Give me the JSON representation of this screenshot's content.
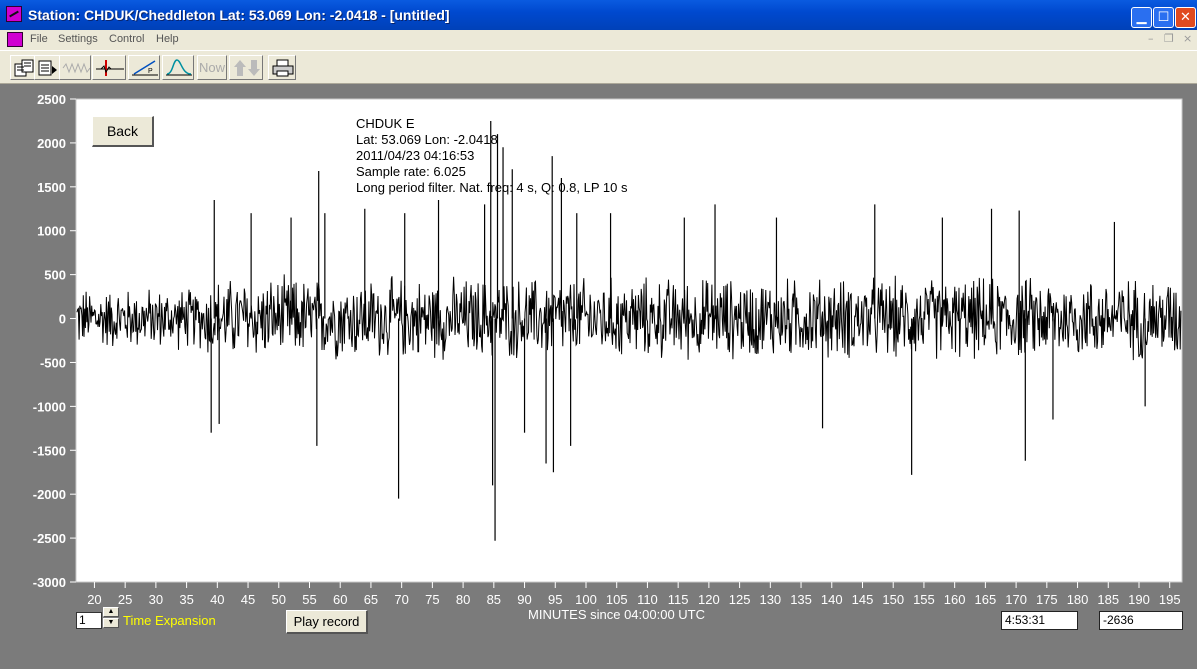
{
  "window": {
    "title": "Station: CHDUK/Cheddleton Lat: 53.069 Lon: -2.0418 - [untitled]",
    "controls": {
      "minimize": "▁",
      "maximize": "☐",
      "close": "✕"
    }
  },
  "menu": {
    "items": [
      "File",
      "Settings",
      "Control",
      "Help"
    ],
    "mdi": {
      "minimize": "–",
      "restore": "❐",
      "close": "×"
    }
  },
  "toolbar": {
    "now_label": "Now",
    "buttons": [
      "open-icon",
      "save-icon",
      "waveform-icon",
      "pick-icon",
      "pwave-icon",
      "spectrum-icon",
      "now-icon",
      "updown-arrows-icon",
      "print-icon"
    ]
  },
  "plot": {
    "back_label": "Back",
    "info": [
      "CHDUK  E",
      "Lat: 53.069 Lon: -2.0418",
      "2011/04/23 04:16:53",
      "Sample rate: 6.025",
      "Long period filter. Nat. freq: 4 s, Q: 0.8, LP 10 s"
    ],
    "xlabel": "MINUTES since 04:00:00 UTC"
  },
  "chart_data": {
    "type": "line",
    "xlabel": "MINUTES since 04:00:00 UTC",
    "ylabel": "",
    "xlim": [
      17,
      197
    ],
    "ylim": [
      -3000,
      2500
    ],
    "xticks": [
      20,
      25,
      30,
      35,
      40,
      45,
      50,
      55,
      60,
      65,
      70,
      75,
      80,
      85,
      90,
      95,
      100,
      105,
      110,
      115,
      120,
      125,
      130,
      135,
      140,
      145,
      150,
      155,
      160,
      165,
      170,
      175,
      180,
      185,
      190,
      195
    ],
    "yticks": [
      2500,
      2000,
      1500,
      1000,
      500,
      0,
      -500,
      -1000,
      -1500,
      -2000,
      -2500,
      -3000
    ],
    "background_noise_amplitude": 350,
    "spikes": [
      {
        "x": 39.5,
        "y": 1350
      },
      {
        "x": 39.0,
        "y": -1300
      },
      {
        "x": 40.3,
        "y": -1200
      },
      {
        "x": 45.5,
        "y": 1200
      },
      {
        "x": 52.0,
        "y": 1150
      },
      {
        "x": 56.5,
        "y": 1680
      },
      {
        "x": 56.2,
        "y": -1450
      },
      {
        "x": 57.5,
        "y": 1200
      },
      {
        "x": 64.0,
        "y": 1250
      },
      {
        "x": 69.5,
        "y": -2050
      },
      {
        "x": 70.5,
        "y": 1200
      },
      {
        "x": 76.0,
        "y": 1350
      },
      {
        "x": 83.5,
        "y": 1300
      },
      {
        "x": 84.5,
        "y": 2250
      },
      {
        "x": 84.8,
        "y": -1900
      },
      {
        "x": 85.2,
        "y": -2530
      },
      {
        "x": 85.6,
        "y": 2100
      },
      {
        "x": 86.5,
        "y": 1950
      },
      {
        "x": 88.0,
        "y": 1700
      },
      {
        "x": 90.0,
        "y": -1300
      },
      {
        "x": 93.5,
        "y": -1650
      },
      {
        "x": 94.5,
        "y": 1850
      },
      {
        "x": 94.7,
        "y": -1750
      },
      {
        "x": 96.0,
        "y": 1600
      },
      {
        "x": 97.5,
        "y": -1450
      },
      {
        "x": 98.5,
        "y": 1200
      },
      {
        "x": 104.0,
        "y": 1200
      },
      {
        "x": 116.0,
        "y": 1150
      },
      {
        "x": 121.0,
        "y": 1300
      },
      {
        "x": 131.0,
        "y": 1150
      },
      {
        "x": 138.5,
        "y": -1250
      },
      {
        "x": 147.0,
        "y": 1300
      },
      {
        "x": 153.0,
        "y": -1780
      },
      {
        "x": 158.0,
        "y": 1150
      },
      {
        "x": 166.0,
        "y": 1250
      },
      {
        "x": 170.5,
        "y": 1230
      },
      {
        "x": 171.5,
        "y": -1620
      },
      {
        "x": 176.0,
        "y": -1150
      },
      {
        "x": 186.0,
        "y": 1100
      },
      {
        "x": 191.0,
        "y": -1000
      }
    ]
  },
  "controls": {
    "time_expansion_value": "1",
    "time_expansion_label": "Time Expansion",
    "play_label": "Play record",
    "time_readout": "4:53:31",
    "value_readout": "-2636"
  }
}
